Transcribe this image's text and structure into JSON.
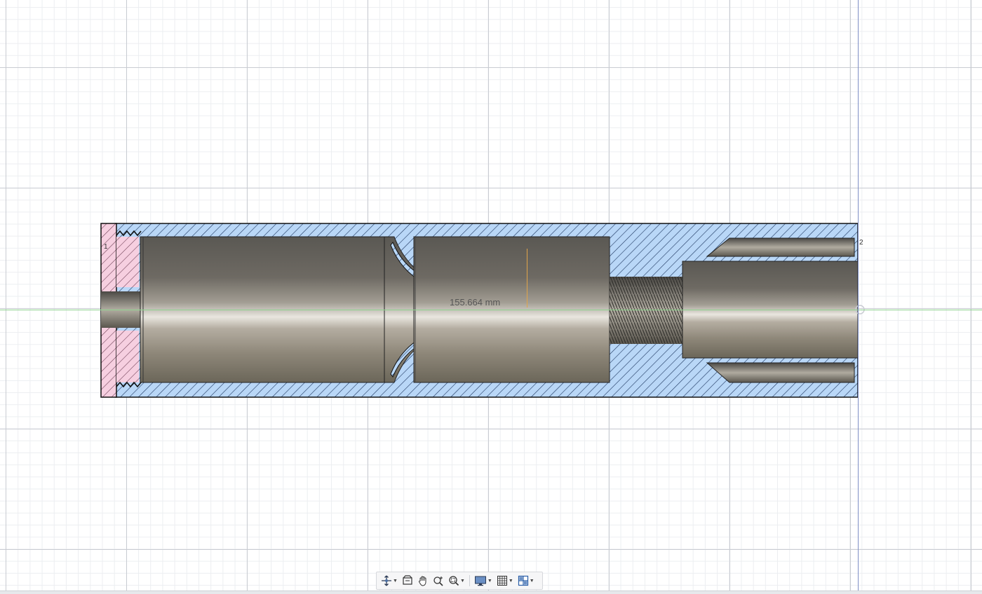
{
  "viewport": {
    "dimension_label": "155.664 mm",
    "point_labels": [
      "1",
      "2"
    ]
  },
  "colors": {
    "section_hatch_blue": "#b9d7f7",
    "section_hatch_pink": "#f6cfe0",
    "axis_x": "#8ed38e",
    "axis_y": "#7f8fc6",
    "dimension_line": "#e0a44a"
  },
  "toolbar": {
    "buttons": [
      {
        "name": "orbit-icon",
        "has_menu": true
      },
      {
        "name": "look-at-icon",
        "has_menu": false
      },
      {
        "name": "pan-icon",
        "has_menu": false
      },
      {
        "name": "zoom-icon",
        "has_menu": false
      },
      {
        "name": "fit-icon",
        "has_menu": true
      },
      {
        "name": "display-settings-icon",
        "has_menu": true
      },
      {
        "name": "grid-snaps-icon",
        "has_menu": true
      },
      {
        "name": "viewports-icon",
        "has_menu": true
      }
    ]
  }
}
